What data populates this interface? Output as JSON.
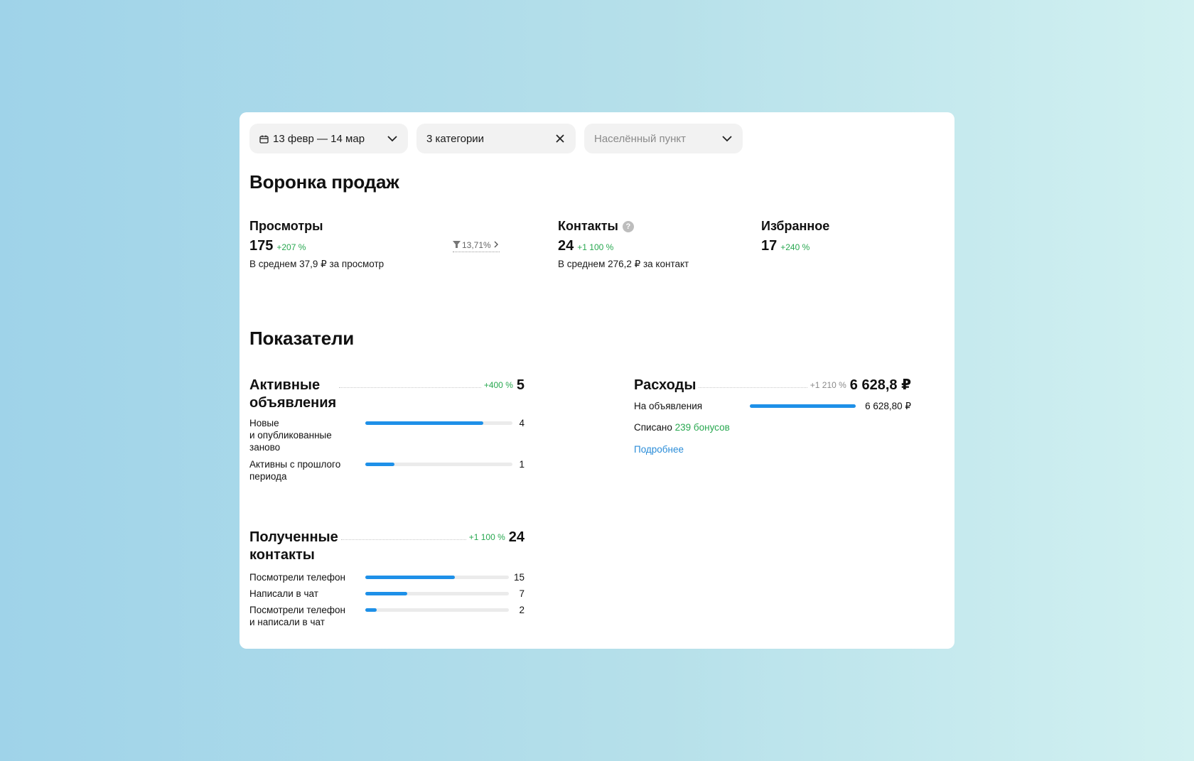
{
  "filters": {
    "date_label": "13 февр — 14 мар",
    "category_label": "3 категории",
    "city_placeholder": "Населённый пункт"
  },
  "funnel": {
    "title": "Воронка продаж",
    "views": {
      "title": "Просмотры",
      "value": "175",
      "change": "+207 %",
      "avg": "В среднем 37,9 ₽ за просмотр",
      "conversion": "13,71%"
    },
    "contacts": {
      "title": "Контакты",
      "value": "24",
      "change": "+1 100 %",
      "avg": "В среднем 276,2 ₽ за контакт"
    },
    "favorites": {
      "title": "Избранное",
      "value": "17",
      "change": "+240 %"
    }
  },
  "metrics": {
    "title": "Показатели",
    "active_ads": {
      "title_line1": "Активные",
      "title_line2": "объявления",
      "change": "+400 %",
      "value": "5",
      "rows": [
        {
          "label_l1": "Новые",
          "label_l2": "и опубликованные",
          "label_l3": "заново",
          "value": "4",
          "fraction": 0.8
        },
        {
          "label_l1": "Активны с прошлого",
          "label_l2": "периода",
          "value": "1",
          "fraction": 0.2
        }
      ]
    },
    "received_contacts": {
      "title_line1": "Полученные",
      "title_line2": "контакты",
      "change": "+1 100 %",
      "value": "24",
      "rows": [
        {
          "label_l1": "Посмотрели телефон",
          "value": "15",
          "fraction": 0.625
        },
        {
          "label_l1": "Написали в чат",
          "value": "7",
          "fraction": 0.29
        },
        {
          "label_l1": "Посмотрели телефон",
          "label_l2": "и написали в чат",
          "value": "2",
          "fraction": 0.08
        }
      ]
    },
    "expenses": {
      "title": "Расходы",
      "change": "+1 210 %",
      "value": "6 628,8 ₽",
      "row_label": "На объявления",
      "row_value": "6 628,80 ₽",
      "row_fraction": 1.0,
      "written_off_prefix": "Списано",
      "written_off_bonus": "239 бонусов",
      "more_link": "Подробнее"
    }
  },
  "colors": {
    "accent_bar": "#1e90e8",
    "positive": "#28a850",
    "link": "#2a8cd8"
  }
}
